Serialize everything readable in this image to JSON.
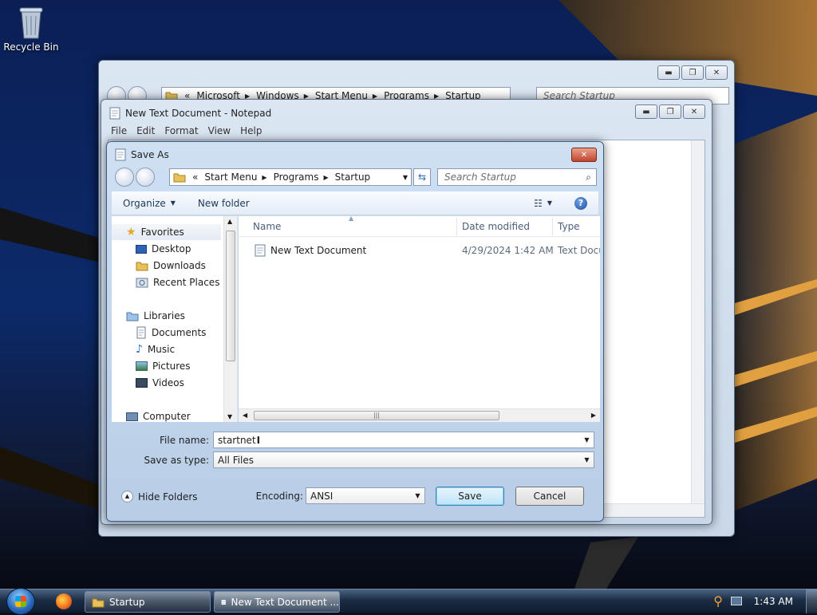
{
  "desktop": {
    "recycle_bin_label": "Recycle Bin"
  },
  "explorer": {
    "breadcrumb": [
      "Microsoft",
      "Windows",
      "Start Menu",
      "Programs",
      "Startup"
    ],
    "breadcrumb_overflow": "«",
    "search_placeholder": "Search Startup"
  },
  "notepad": {
    "title": "New Text Document - Notepad",
    "menu": [
      "File",
      "Edit",
      "Format",
      "View",
      "Help"
    ]
  },
  "saveas": {
    "title": "Save As",
    "breadcrumb_overflow": "«",
    "breadcrumb": [
      "Start Menu",
      "Programs",
      "Startup"
    ],
    "search_placeholder": "Search Startup",
    "toolbar": {
      "organize": "Organize",
      "new_folder": "New folder"
    },
    "nav": {
      "favorites": "Favorites",
      "desktop": "Desktop",
      "downloads": "Downloads",
      "recent_places": "Recent Places",
      "libraries": "Libraries",
      "documents": "Documents",
      "music": "Music",
      "pictures": "Pictures",
      "videos": "Videos",
      "computer": "Computer"
    },
    "columns": {
      "name": "Name",
      "date_modified": "Date modified",
      "type": "Type"
    },
    "files": [
      {
        "name": "New Text Document",
        "date": "4/29/2024 1:42 AM",
        "type": "Text Docu"
      }
    ],
    "file_name_label": "File name:",
    "file_name_value": "startnet",
    "save_as_type_label": "Save as type:",
    "save_as_type_value": "All Files",
    "hide_folders": "Hide Folders",
    "encoding_label": "Encoding:",
    "encoding_value": "ANSI",
    "save_button": "Save",
    "cancel_button": "Cancel"
  },
  "taskbar": {
    "items": [
      "Startup",
      "New Text Document ..."
    ],
    "clock": "1:43 AM"
  },
  "colors": {
    "accent": "#2a6bbf",
    "close_red": "#c2452c",
    "wallpaper_sky": "#0c2a6a"
  }
}
